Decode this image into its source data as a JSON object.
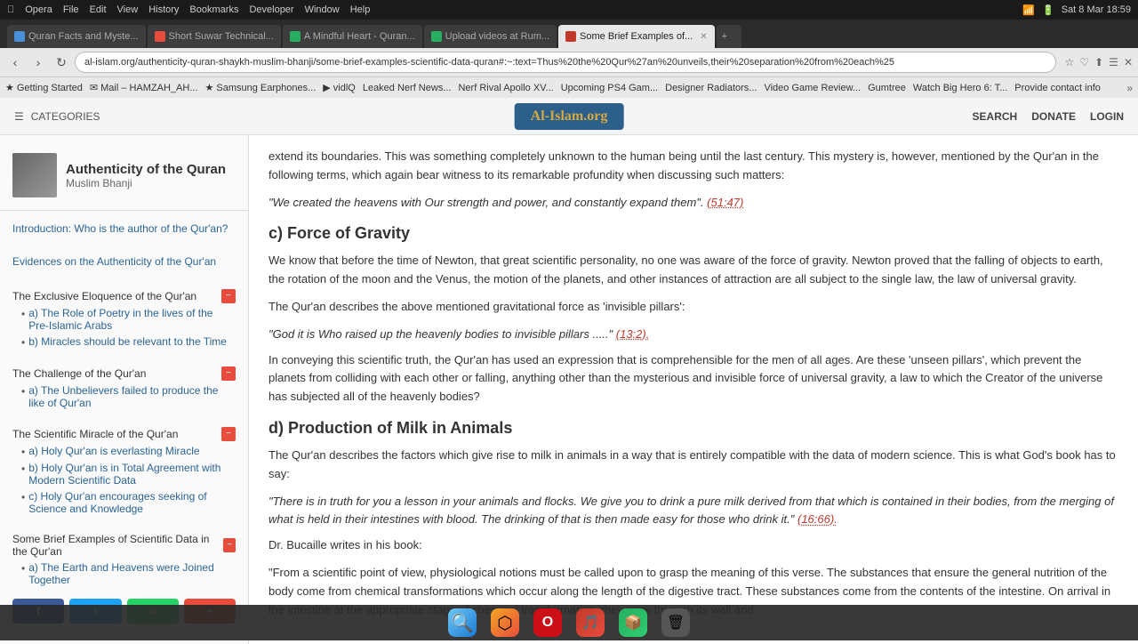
{
  "os": {
    "left_items": [
      "⌘",
      "Opera",
      "File",
      "Edit",
      "View",
      "History",
      "Bookmarks",
      "Developer",
      "Window",
      "Help"
    ],
    "right_items": [
      "Sat 8 Mar",
      "18:59"
    ],
    "wifi": "WiFi",
    "battery": "100%"
  },
  "browser": {
    "tabs": [
      {
        "id": "quran-facts",
        "label": "Quran Facts and Myste...",
        "favicon_color": "#4a90d9",
        "active": false
      },
      {
        "id": "short-suwar",
        "label": "Short Suwar Technical...",
        "favicon_color": "#e74c3c",
        "active": false
      },
      {
        "id": "mindful-heart",
        "label": "A Mindful Heart - Quran...",
        "favicon_color": "#27ae60",
        "active": false
      },
      {
        "id": "upload-videos",
        "label": "Upload videos at Rum...",
        "favicon_color": "#27ae60",
        "active": false
      },
      {
        "id": "some-brief",
        "label": "Some Brief Examples of...",
        "favicon_color": "#c0392b",
        "active": true
      }
    ],
    "address": "al-islam.org/authenticity-quran-shaykh-muslim-bhanji/some-brief-examples-scientific-data-quran#:~:text=Thus%20the%20Qur%27an%20unveils,their%20separation%20from%20each%25",
    "bookmarks": [
      "Getting Started",
      "Mail - HAMZAH_AH...",
      "Samsung Earphones...",
      "vidlQ",
      "Leaked Nerf News...",
      "Nerf Rival Apollo XV...",
      "Upcoming PS4 Gam...",
      "Designer Radiators...",
      "Video Game Review...",
      "Gumtree",
      "Watch Big Hero 6: T...",
      "Provide contact info"
    ]
  },
  "site_header": {
    "categories_label": "CATEGORIES",
    "logo": "Al-Islam.org",
    "search_label": "SEARCH",
    "donate_label": "DONATE",
    "login_label": "LOGIN"
  },
  "sidebar": {
    "author": {
      "name": "Authenticity of the Quran",
      "sub": "Muslim Bhanji"
    },
    "nav_items": [
      {
        "title": "Introduction: Who is the author of the Qur'an?",
        "type": "simple"
      },
      {
        "title": "Evidences on the Authenticity of the Qur'an",
        "type": "simple"
      },
      {
        "title": "The Exclusive Eloquence of the Qur'an",
        "type": "collapsible",
        "sub_items": [
          "a) The Role of Poetry in the lives of the Pre-Islamic Arabs",
          "b) Miracles should be relevant to the Time"
        ]
      },
      {
        "title": "The Challenge of the Qur'an",
        "type": "collapsible",
        "sub_items": [
          "a) The Unbelievers failed to produce the like of Qur'an"
        ]
      },
      {
        "title": "The Scientific Miracle of the Qur'an",
        "type": "collapsible",
        "sub_items": [
          "a) Holy Qur'an is everlasting Miracle",
          "b) Holy Qur'an is in Total Agreement with Modern Scientific Data",
          "c) Holy Qur'an encourages seeking of Science and Knowledge"
        ]
      },
      {
        "title": "Some Brief Examples of Scientific Data in the Qur'an",
        "type": "collapsible",
        "sub_items": [
          "a) The Earth and Heavens were Joined Together"
        ]
      }
    ],
    "social_buttons": [
      {
        "label": "f",
        "type": "fb"
      },
      {
        "label": "t",
        "type": "tw"
      },
      {
        "label": "w",
        "type": "wa"
      },
      {
        "label": "+",
        "type": "plus"
      }
    ]
  },
  "content": {
    "intro_text": "extend its boundaries. This was something completely unknown to the human being until the last century. This mystery is, however, mentioned by the Qur'an in the following terms, which again bear witness to its remarkable profundity when discussing such matters:",
    "quote1": "\"We created the heavens with Our strength and power, and constantly expand them\". (51:47)",
    "section_c": {
      "heading": "c) Force of Gravity",
      "para1": "We know that before the time of Newton, that great scientific personality, no one was aware of the force of gravity. Newton proved that the falling of objects to earth, the rotation of the moon and the Venus, the motion of the planets, and other instances of attraction are all subject to the single law, the law of universal gravity.",
      "para2": "The Qur'an describes the above mentioned gravitational force as 'invisible pillars':",
      "quote": "\"God it is Who raised up the heavenly bodies to invisible pillars .....\" (13:2).",
      "para3": "In conveying this scientific truth, the Qur'an has used an expression that is comprehensible for the men of all ages. Are these 'unseen pillars', which prevent the planets from colliding with each other or falling, anything other than the mysterious and invisible force of universal gravity, a law to which the Creator of the universe has subjected all of the heavenly bodies?"
    },
    "section_d": {
      "heading": "d) Production of Milk in Animals",
      "para1": "The Qur'an describes the factors which give rise to milk in animals in a way that is entirely compatible with the data of modern science. This is what God's book has to say:",
      "quote": "\"There is in truth for you a lesson in your animals and flocks. We give you to drink a pure milk derived from that which is contained in their bodies, from the merging of what is held in their intestines with blood. The drinking of that is then made easy for those who drink it.\" (16:66).",
      "para2": "Dr. Bucaille writes in his book:",
      "quote2": "\"From a scientific point of view, physiological notions must be called upon to grasp the meaning of this verse. The substances that ensure the general nutrition of the body come from chemical transformations which occur along the length of the digestive tract. These substances come from the contents of the intestine. On arrival in the intestine at the appropriate stage of chemical transformation, they pass through its wall and"
    }
  },
  "taskbar": {
    "icons": [
      "🔍",
      "🚀",
      "🔴",
      "🎵",
      "📦",
      "🗑️"
    ]
  }
}
